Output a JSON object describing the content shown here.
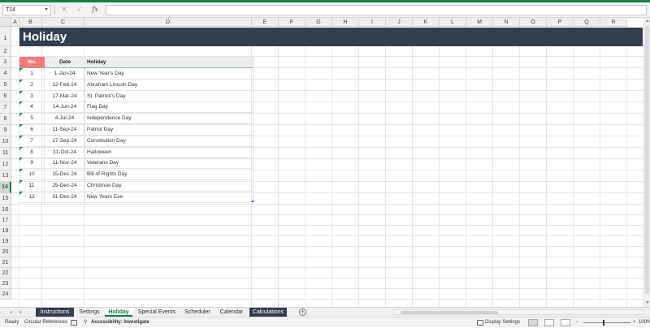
{
  "formula_bar": {
    "name_box": "T14",
    "cancel_icon": "close-icon",
    "enter_icon": "check-icon",
    "function_label": "fx",
    "formula_value": ""
  },
  "columns": [
    "A",
    "B",
    "C",
    "D",
    "E",
    "F",
    "G",
    "H",
    "I",
    "J",
    "K",
    "L",
    "M",
    "N",
    "O",
    "P",
    "Q",
    "R"
  ],
  "rows": [
    "1",
    "2",
    "3",
    "4",
    "5",
    "6",
    "7",
    "8",
    "9",
    "10",
    "11",
    "12",
    "13",
    "14",
    "15",
    "16",
    "17",
    "18",
    "19",
    "20",
    "21",
    "22",
    "23",
    "24"
  ],
  "selected_row": "14",
  "title": "Holiday",
  "table": {
    "headers": {
      "no": "No.",
      "date": "Date",
      "holiday": "Holiday"
    },
    "rows": [
      {
        "no": "1",
        "date": "1-Jan-24",
        "holiday": "New Year's Day"
      },
      {
        "no": "2",
        "date": "12-Feb-24",
        "holiday": "Abraham Lincoln Day"
      },
      {
        "no": "3",
        "date": "17-Mar-24",
        "holiday": "St. Patrick's Day"
      },
      {
        "no": "4",
        "date": "14-Jun-24",
        "holiday": "Flag Day"
      },
      {
        "no": "5",
        "date": "4-Jul-24",
        "holiday": "Independence Day"
      },
      {
        "no": "6",
        "date": "11-Sep-24",
        "holiday": "Patriot Day"
      },
      {
        "no": "7",
        "date": "17-Sep-24",
        "holiday": "Constitution Day"
      },
      {
        "no": "8",
        "date": "31-Oct-24",
        "holiday": "Halloween"
      },
      {
        "no": "9",
        "date": "11-Nov-24",
        "holiday": "Veterans Day"
      },
      {
        "no": "10",
        "date": "15-Dec-24",
        "holiday": "Bill of Rights Day"
      },
      {
        "no": "11",
        "date": "25-Dec-24",
        "holiday": "Christmas Day"
      },
      {
        "no": "12",
        "date": "31-Dec-24",
        "holiday": "New Years Eve"
      }
    ]
  },
  "sheet_tabs": [
    {
      "label": "Instructions",
      "style": "dark"
    },
    {
      "label": "Settings",
      "style": "normal"
    },
    {
      "label": "Holiday",
      "style": "active"
    },
    {
      "label": "Special Events",
      "style": "normal"
    },
    {
      "label": "Scheduler",
      "style": "normal"
    },
    {
      "label": "Calendar",
      "style": "normal"
    },
    {
      "label": "Calculations",
      "style": "dark"
    }
  ],
  "add_sheet_label": "+",
  "status_bar": {
    "ready": "Ready",
    "circular": "Circular References",
    "accessibility": "Accessibility: Investigate",
    "display_settings": "Display Settings",
    "zoom": "100%"
  },
  "colors": {
    "title_band": "#323e4f",
    "header_no": "#f07b7b",
    "accent_green": "#1f7a45"
  }
}
